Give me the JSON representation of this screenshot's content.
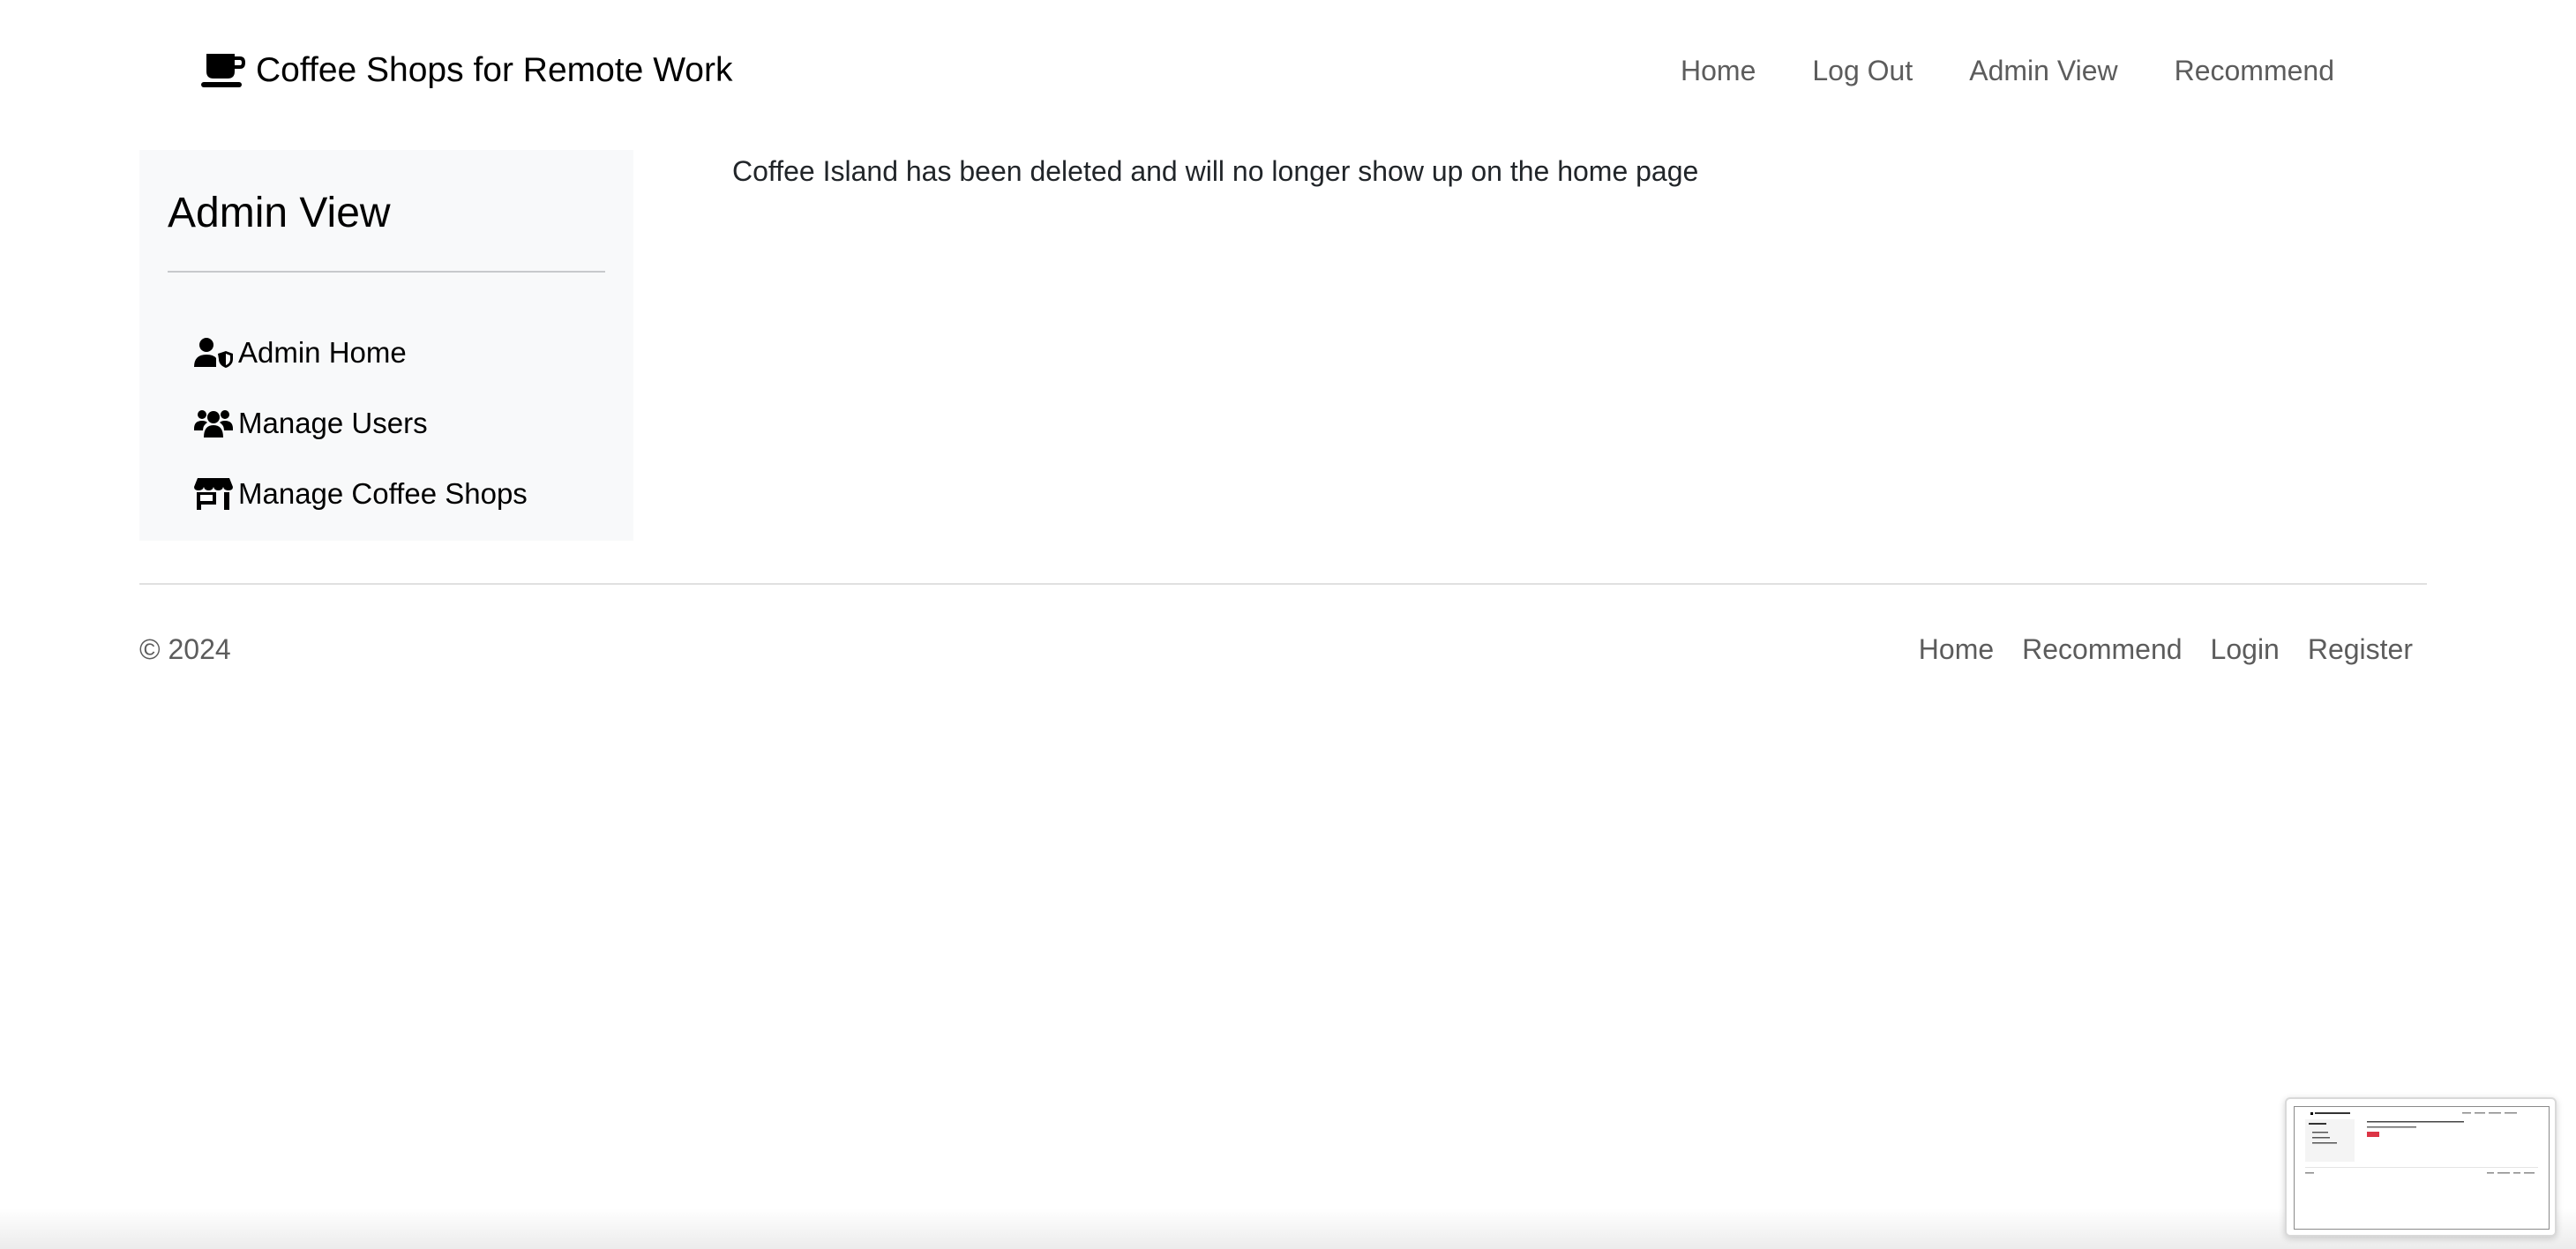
{
  "header": {
    "brand": "Coffee Shops for Remote Work",
    "brand_icon": "coffee-cup-icon",
    "nav": [
      {
        "label": "Home"
      },
      {
        "label": "Log Out"
      },
      {
        "label": "Admin View"
      },
      {
        "label": "Recommend"
      }
    ]
  },
  "sidebar": {
    "title": "Admin View",
    "items": [
      {
        "label": "Admin Home",
        "icon": "user-shield-icon"
      },
      {
        "label": "Manage Users",
        "icon": "users-icon"
      },
      {
        "label": "Manage Coffee Shops",
        "icon": "shop-icon"
      }
    ]
  },
  "main": {
    "message": "Coffee Island has been deleted and will no longer show up on the home page"
  },
  "footer": {
    "copyright": "© 2024",
    "links": [
      {
        "label": "Home"
      },
      {
        "label": "Recommend"
      },
      {
        "label": "Login"
      },
      {
        "label": "Register"
      }
    ]
  },
  "colors": {
    "sidebar_bg": "#f8f9fa",
    "nav_text": "#5c5c5c",
    "preview_button": "#dc3545"
  }
}
